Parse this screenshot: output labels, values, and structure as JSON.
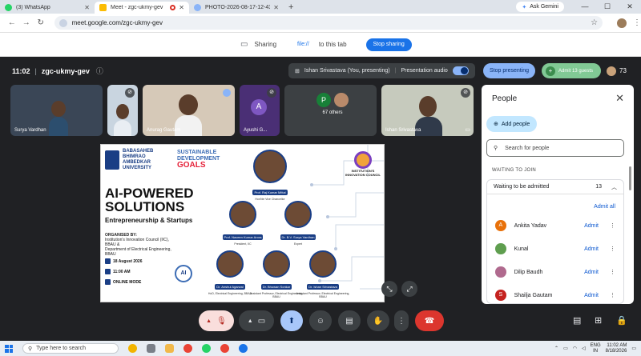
{
  "browser": {
    "tabs": [
      {
        "label": "(3) WhatsApp",
        "color": "#25d366"
      },
      {
        "label": "Meet - zgc-ukmy-gev",
        "color": "#fbbc04"
      },
      {
        "label": "PHOTO-2026-08-17-12-43",
        "color": "#8ab4f8"
      }
    ],
    "new_tab_icon": "+",
    "gemini_label": "Ask Gemini",
    "url": "meet.google.com/zgc-ukmy-gev"
  },
  "sharebar": {
    "sharing_label": "Sharing",
    "file_label": "file://",
    "to_tab_label": "to this tab",
    "stop_label": "Stop sharing"
  },
  "meet": {
    "time": "11:02",
    "meeting_code": "zgc-ukmy-gev",
    "presenting_label": "Ishan Srivastava (You, presenting)",
    "audio_label": "Presentation audio",
    "stop_presenting": "Stop presenting",
    "admit_pill": "Admit 13 guests",
    "participant_count": "73",
    "tiles": [
      {
        "name": "Surya Vardhan"
      },
      {
        "name": ""
      },
      {
        "name": "Anurag Gautam"
      },
      {
        "name": "Ayushi G...",
        "initial": "A"
      },
      {
        "name": "67 others",
        "initial": "P"
      },
      {
        "name": "Ishan Srivastava"
      }
    ]
  },
  "slide": {
    "university": [
      "BABASAHEB",
      "BHIMRAO",
      "AMBEDKAR",
      "UNIVERSITY"
    ],
    "sdg_top": "SUSTAINABLE",
    "sdg_mid": "DEVELOPMENT",
    "sdg_goals": "GOALS",
    "council": "INSTITUTION'S INNOVATION COUNCIL",
    "title_line1": "AI-POWERED",
    "title_line2": "SOLUTIONS",
    "subtitle": "Entrepreneurship & Startups",
    "organised_by": "ORGANISED BY:",
    "org_line1": "Institution's Innovation Council (IIC),",
    "org_line2": "BBAU &",
    "org_line3": "Department of Electrical Engineering,",
    "org_line4": "BBAU",
    "date": "18 August 2026",
    "time": "11:00 AM",
    "mode": "ONLINE MODE",
    "ai_chip": "AI",
    "speakers": [
      {
        "name": "Prof. Raj Kumar Mittal",
        "desc": "Hon'ble Vice Chancellor"
      },
      {
        "name": "Prof. Naveen Kumar Arora",
        "desc": "President, IIC"
      },
      {
        "name": "Dr. B.V. Surya Vardhan",
        "desc": "Expert"
      },
      {
        "name": "Dr. Anshul Agarwal",
        "desc": "HoD, Electrical Engineering, BBAU"
      },
      {
        "name": "Dr. Bhuwan Sonkar",
        "desc": "Assistant Professor, Electrical Engineering, BBAU"
      },
      {
        "name": "Dr. Ishan Srivastava",
        "desc": "Assistant Professor, Electrical Engineering, BBAU"
      }
    ]
  },
  "people": {
    "title": "People",
    "add_people": "Add people",
    "search_placeholder": "Search for people",
    "waiting_header": "WAITING TO JOIN",
    "waiting_label": "Waiting to be admitted",
    "waiting_count": "13",
    "admit_all": "Admit all",
    "admit_label": "Admit",
    "guests": [
      {
        "name": "Ankita Yadav",
        "initial": "A",
        "color": "#e8710a"
      },
      {
        "name": "Kunal",
        "initial": "",
        "color": "#5f9e4f"
      },
      {
        "name": "Dilip Baudh",
        "initial": "",
        "color": "#b06a8e"
      },
      {
        "name": "Shailja Gautam",
        "initial": "S",
        "color": "#c5221f"
      }
    ]
  },
  "taskbar": {
    "search_label": "Type here to search",
    "lang_top": "ENG",
    "lang_bottom": "IN",
    "time": "11:02 AM",
    "date": "8/18/2026"
  }
}
